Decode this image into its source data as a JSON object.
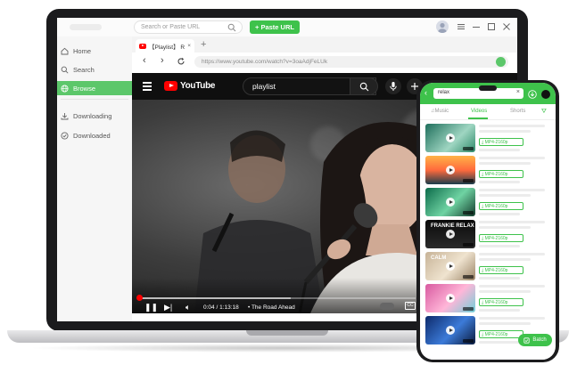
{
  "desktop": {
    "search_placeholder": "Search or Paste URL",
    "paste_button": "+ Paste URL",
    "sidebar": {
      "items": [
        {
          "label": "Home",
          "icon": "home-icon",
          "active": false
        },
        {
          "label": "Search",
          "icon": "search-icon",
          "active": false
        },
        {
          "label": "Browse",
          "icon": "globe-icon",
          "active": true
        },
        {
          "label": "Downloading",
          "icon": "download-icon",
          "active": false
        },
        {
          "label": "Downloaded",
          "icon": "check-circle-icon",
          "active": false
        }
      ]
    },
    "tab": {
      "title": "【Playlist】 R",
      "close": "×",
      "new": "+"
    },
    "url": "https://www.youtube.com/watch?v=3oaAdjFeLUk",
    "youtube": {
      "logo_text": "YouTube",
      "search_query": "playlist"
    },
    "player": {
      "time": "0:04 / 1:13:18",
      "chapter": "• The Road Ahead",
      "progress": 0.006,
      "buffered": 0.55
    }
  },
  "phone": {
    "search_value": "relax",
    "clear": "×",
    "tabs": [
      "Music",
      "Videos",
      "Shorts"
    ],
    "active_tab": "Videos",
    "videos": [
      {
        "format": "MP4-2160p",
        "thumb_text": ""
      },
      {
        "format": "MP4-2160p",
        "thumb_text": ""
      },
      {
        "format": "MP4-2160p",
        "thumb_text": ""
      },
      {
        "format": "MP4-2160p",
        "thumb_text": "FRANKIE RELAX"
      },
      {
        "format": "MP4-2160p",
        "thumb_text": "CALM"
      },
      {
        "format": "MP4-2160p",
        "thumb_text": ""
      },
      {
        "format": "MP4-2160p",
        "thumb_text": ""
      }
    ],
    "batch_label": "Batch"
  },
  "colors": {
    "accent": "#3ec24b",
    "youtube_red": "#ff0000",
    "dark_frame": "#1b1b1d"
  }
}
